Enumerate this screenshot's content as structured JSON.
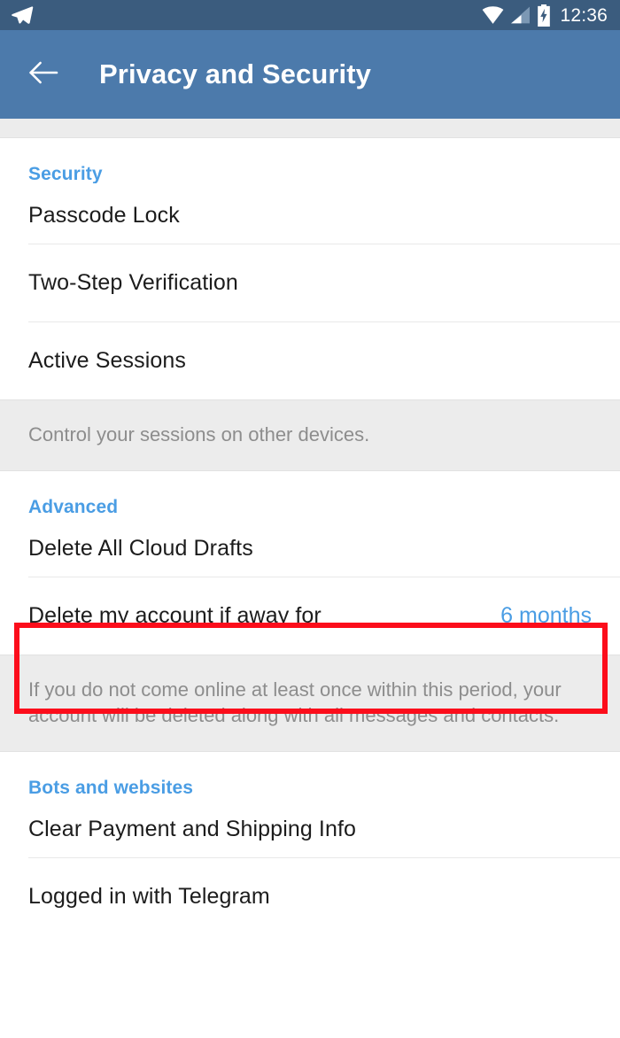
{
  "status_bar": {
    "notification_icon": "telegram-paper-plane-icon",
    "wifi_icon": "wifi-icon",
    "signal_icon": "cellular-signal-icon",
    "battery_icon": "battery-charging-icon",
    "time": "12:36",
    "background_color": "#3b5c7e"
  },
  "toolbar": {
    "back_icon": "back-arrow-icon",
    "title": "Privacy and Security",
    "background_color": "#4c7aab"
  },
  "theme": {
    "accent_color": "#4a9de4",
    "highlight_color": "#fc0d1b",
    "note_background": "#ececec",
    "primary_text": "#1c1c1c",
    "secondary_text": "#8d8d8d"
  },
  "sections": [
    {
      "header": "Security",
      "rows": [
        {
          "label": "Passcode Lock",
          "value": ""
        },
        {
          "label": "Two-Step Verification",
          "value": ""
        },
        {
          "label": "Active Sessions",
          "value": ""
        }
      ],
      "note": "Control your sessions on other devices."
    },
    {
      "header": "Advanced",
      "rows": [
        {
          "label": "Delete All Cloud Drafts",
          "value": ""
        },
        {
          "label": "Delete my account if away for",
          "value": "6 months"
        }
      ],
      "note": "If you do not come online at least once within this period, your account will be deleted along with all messages and contacts."
    },
    {
      "header": "Bots and websites",
      "rows": [
        {
          "label": "Clear Payment and Shipping Info",
          "value": ""
        },
        {
          "label": "Logged in with Telegram",
          "value": ""
        }
      ],
      "note": ""
    }
  ]
}
